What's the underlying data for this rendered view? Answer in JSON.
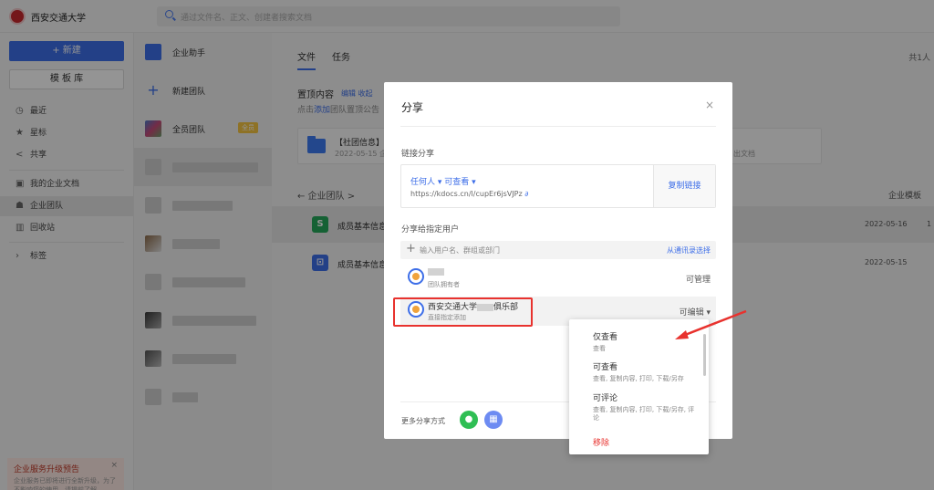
{
  "topbar": {
    "brand": "西安交通大学",
    "search_placeholder": "通过文件名、正文、创建者搜索文档"
  },
  "left": {
    "new_label": "+ 新建",
    "template_label": "模 板 库",
    "nav": [
      {
        "label": "最近",
        "icon": "clock-icon"
      },
      {
        "label": "星标",
        "icon": "star-icon"
      },
      {
        "label": "共享",
        "icon": "share-icon"
      },
      {
        "label": "我的企业文档",
        "icon": "doc-icon"
      },
      {
        "label": "企业团队",
        "icon": "team-icon"
      },
      {
        "label": "回收站",
        "icon": "trash-icon"
      },
      {
        "label": "标签",
        "icon": "tag-icon"
      }
    ],
    "notice": {
      "title": "企业服务升级预告",
      "desc": "企业服务已即将进行全新升级，为了不影响您的使用，请提前了解"
    }
  },
  "teams": [
    {
      "name": "企业助手"
    },
    {
      "name": "新建团队"
    },
    {
      "name": "全员团队",
      "badge": "全员"
    }
  ],
  "main": {
    "tabs": [
      "文件",
      "任务"
    ],
    "count_text": "共1人",
    "pinned_title": "置顶内容",
    "pinned_links": "编辑 收起",
    "pinned_note_pre": "点击",
    "pinned_note_link": "添加",
    "pinned_note_post": "团队置顶公告",
    "card_title": "【社团信息】",
    "card_date": "2022-05-15 企业",
    "card_right": "出文档",
    "breadcrumb": "←   企业团队 >",
    "breadcrumb_right": "企业模板",
    "files": [
      {
        "name": "成员基本信息",
        "date": "2022-05-16",
        "extra": "1"
      },
      {
        "name": "成员基本信息",
        "date": "2022-05-15",
        "extra": ""
      }
    ]
  },
  "modal": {
    "title": "分享",
    "close": "×",
    "link_section": "链接分享",
    "link_perm": "任何人 ▾   可查看 ▾",
    "link_url": "https://kdocs.cn/l/cupEr6jsVJPz",
    "copy_label": "复制链接",
    "user_section": "分享给指定用户",
    "user_placeholder": "输入用户名、群组或部门",
    "pick_label": "从通讯录选择",
    "members": [
      {
        "sub": "团队拥有者",
        "role": "可管理"
      },
      {
        "name_pre": "西安交通大学",
        "name_post": "俱乐部",
        "sub": "直接指定添加",
        "role": "可编辑 ▾"
      }
    ],
    "more_label": "更多分享方式"
  },
  "dropdown": [
    {
      "title": "仅查看",
      "desc": "查看"
    },
    {
      "title": "可查看",
      "desc": "查看, 复制内容, 打印, 下载/另存"
    },
    {
      "title": "可评论",
      "desc": "查看, 复制内容, 打印, 下载/另存, 评论"
    },
    {
      "title": "移除",
      "desc": ""
    }
  ]
}
